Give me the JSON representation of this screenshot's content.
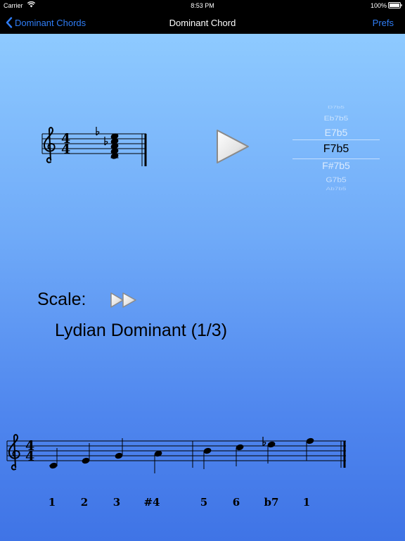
{
  "status_bar": {
    "carrier": "Carrier",
    "time": "8:53 PM",
    "battery": "100%"
  },
  "nav": {
    "back_label": "Dominant Chords",
    "title": "Dominant Chord",
    "prefs_label": "Prefs"
  },
  "picker": {
    "items": [
      "D7b5",
      "Eb7b5",
      "E7b5",
      "F7b5",
      "F#7b5",
      "G7b5",
      "Ab7b5"
    ],
    "selected": "F7b5"
  },
  "scale": {
    "label": "Scale:",
    "name": "Lydian Dominant (1/3)",
    "degrees": [
      "1",
      "2",
      "3",
      "#4",
      "5",
      "6",
      "b7",
      "1"
    ]
  },
  "chord_staff": {
    "time_signature": [
      "4",
      "4"
    ]
  },
  "scale_staff": {
    "time_signature": [
      "4",
      "4"
    ]
  },
  "colors": {
    "accent": "#2f7df6",
    "background_top": "#8ecaff",
    "background_bottom": "#3f74e6"
  },
  "icons": {
    "back": "chevron-left-icon",
    "play": "play-icon",
    "fast_forward": "fast-forward-icon",
    "wifi": "wifi-icon",
    "battery": "battery-icon"
  }
}
